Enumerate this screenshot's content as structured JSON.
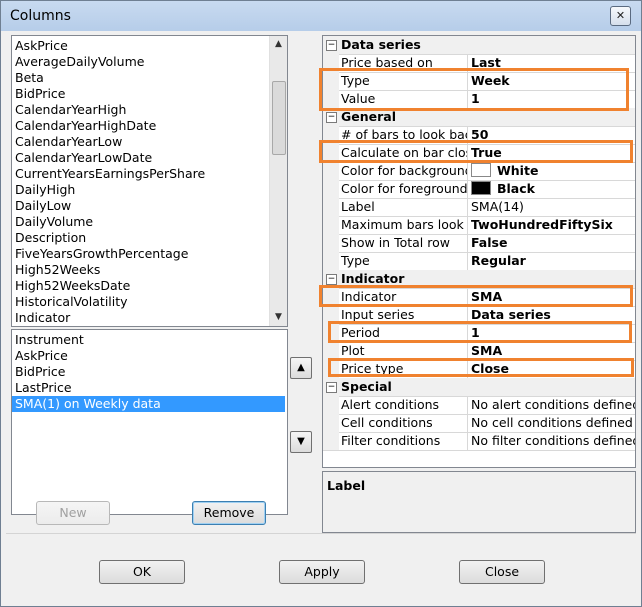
{
  "window": {
    "title": "Columns",
    "close_glyph": "✕"
  },
  "available_columns": [
    "AskPrice",
    "AverageDailyVolume",
    "Beta",
    "BidPrice",
    "CalendarYearHigh",
    "CalendarYearHighDate",
    "CalendarYearLow",
    "CalendarYearLowDate",
    "CurrentYearsEarningsPerShare",
    "DailyHigh",
    "DailyLow",
    "DailyVolume",
    "Description",
    "FiveYearsGrowthPercentage",
    "High52Weeks",
    "High52WeeksDate",
    "HistoricalVolatility",
    "Indicator"
  ],
  "selected_columns": {
    "items": [
      "Instrument",
      "AskPrice",
      "BidPrice",
      "LastPrice",
      "SMA(1) on Weekly data"
    ],
    "selected_index": 4
  },
  "buttons": {
    "new": "New",
    "remove": "Remove",
    "ok": "OK",
    "apply": "Apply",
    "close": "Close",
    "move_up": "▲",
    "move_down": "▼"
  },
  "property_grid": {
    "collapse_glyph": "−",
    "categories": [
      {
        "name": "Data series",
        "rows": [
          {
            "name": "Price based on",
            "value": "Last"
          },
          {
            "name": "Type",
            "value": "Week"
          },
          {
            "name": "Value",
            "value": "1"
          }
        ]
      },
      {
        "name": "General",
        "rows": [
          {
            "name": "# of bars to look back",
            "value": "50"
          },
          {
            "name": "Calculate on bar close",
            "value": "True"
          },
          {
            "name": "Color for background",
            "value": "White",
            "swatch": "#ffffff"
          },
          {
            "name": "Color for foreground",
            "value": "Black",
            "swatch": "#000000"
          },
          {
            "name": "Label",
            "value": "SMA(14)",
            "bold": false
          },
          {
            "name": "Maximum bars look back",
            "value": "TwoHundredFiftySix"
          },
          {
            "name": "Show in Total row",
            "value": "False"
          },
          {
            "name": "Type",
            "value": "Regular"
          }
        ]
      },
      {
        "name": "Indicator",
        "rows": [
          {
            "name": "Indicator",
            "value": "SMA"
          },
          {
            "name": "Input series",
            "value": "Data series"
          },
          {
            "name": "Period",
            "value": "1"
          },
          {
            "name": "Plot",
            "value": "SMA"
          },
          {
            "name": "Price type",
            "value": "Close"
          }
        ]
      },
      {
        "name": "Special",
        "rows": [
          {
            "name": "Alert conditions",
            "value": "No alert conditions defined",
            "bold": false
          },
          {
            "name": "Cell conditions",
            "value": "No cell conditions defined",
            "bold": false
          },
          {
            "name": "Filter conditions",
            "value": "No filter conditions defined",
            "bold": false
          }
        ]
      }
    ]
  },
  "description": {
    "title": "Label"
  },
  "colors": {
    "highlight": "#f0822f",
    "selection": "#3399ff"
  }
}
